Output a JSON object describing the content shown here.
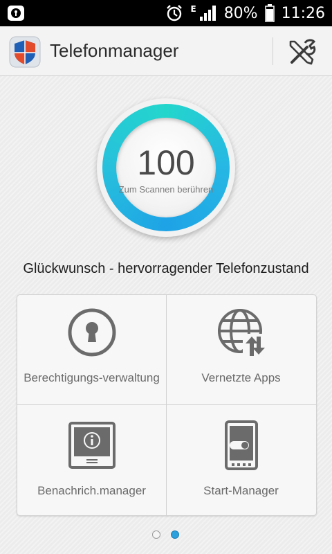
{
  "status_bar": {
    "network_type": "E",
    "battery": "80%",
    "time": "11:26"
  },
  "app": {
    "title": "Telefonmanager",
    "logo_icon": "shield-icon",
    "settings_icon": "tools-icon"
  },
  "scan": {
    "score": "100",
    "hint": "Zum Scannen berühren"
  },
  "message": "Glückwunsch - hervorragender Telefonzustand",
  "tiles": [
    {
      "label": "Berechtigungs-verwaltung",
      "icon": "keyhole-icon"
    },
    {
      "label": "Vernetzte Apps",
      "icon": "globe-network-icon"
    },
    {
      "label": "Benachrich.manager",
      "icon": "notification-info-icon"
    },
    {
      "label": "Start-Manager",
      "icon": "phone-toggle-icon"
    }
  ],
  "pagination": {
    "pages": 2,
    "active": 2
  },
  "colors": {
    "accent": "#27b7e4",
    "ring_teal": "#23d6cc",
    "icon_gray": "#6b6b6b"
  }
}
